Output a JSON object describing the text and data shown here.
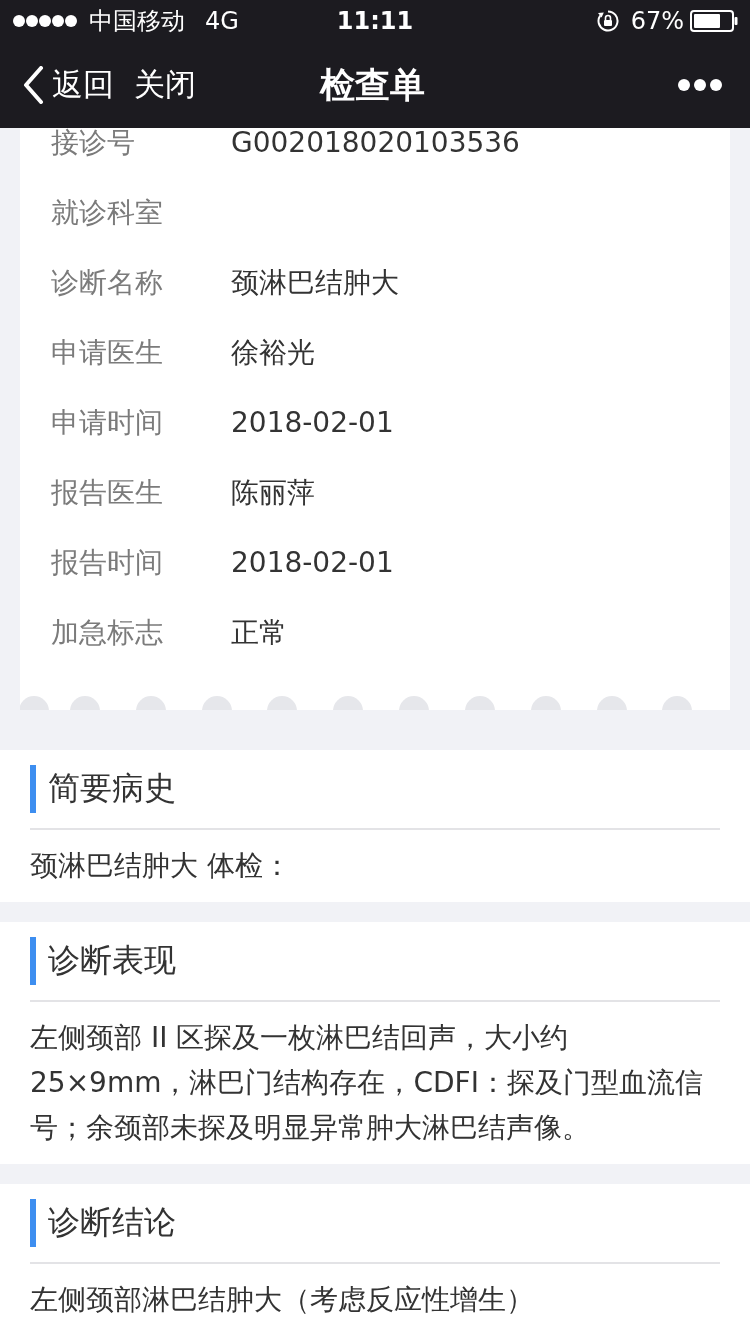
{
  "status_bar": {
    "carrier": "中国移动",
    "network": "4G",
    "time": "11:11",
    "battery": "67%"
  },
  "nav_bar": {
    "back": "返回",
    "close": "关闭",
    "title": "检查单"
  },
  "info_card": {
    "rows": [
      {
        "label": "接诊号",
        "value": "G002018020103536"
      },
      {
        "label": "就诊科室"
      },
      {
        "label": "诊断名称",
        "value": "颈淋巴结肿大"
      },
      {
        "label": "申请医生",
        "value": "徐裕光"
      },
      {
        "label": "申请时间",
        "value": "2018-02-01"
      },
      {
        "label": "报告医生",
        "value": "陈丽萍"
      },
      {
        "label": "报告时间",
        "value": "2018-02-01"
      },
      {
        "label": "加急标志",
        "value": "正常"
      }
    ]
  },
  "sections": [
    {
      "title": "简要病史",
      "text": "颈淋巴结肿大 体检："
    },
    {
      "title": "诊断表现",
      "text": "左侧颈部 II 区探及一枚淋巴结回声，大小约25×9mm，淋巴门结构存在，CDFI：探及门型血流信号；余颈部未探及明显异常肿大淋巴结声像。"
    },
    {
      "title": "诊断结论",
      "text": "左侧颈部淋巴结肿大（考虑反应性增生）"
    }
  ]
}
